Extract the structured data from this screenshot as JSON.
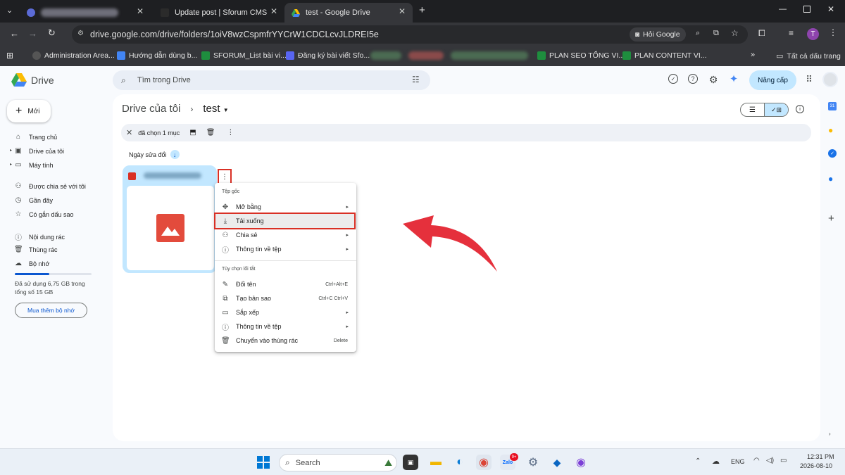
{
  "browser": {
    "tabs": [
      {
        "label": ""
      },
      {
        "label": "Update post | Sforum CMS"
      },
      {
        "label": "test - Google Drive"
      }
    ],
    "url": "drive.google.com/drive/folders/1oiV8wzCspmfrYYCrW1CDCLcvJLDREI5e",
    "ask_google_label": "Hỏi Google",
    "profile_initial": "T",
    "bookmarks": [
      {
        "label": "Administration Area..."
      },
      {
        "label": "Hướng dẫn dùng b..."
      },
      {
        "label": "SFORUM_List bài vi..."
      },
      {
        "label": "Đăng ký bài viết Sfo..."
      },
      {
        "label": "PLAN SEO TỔNG VI..."
      },
      {
        "label": "PLAN CONTENT VI..."
      }
    ],
    "all_bookmarks_label": "Tất cả dấu trang"
  },
  "drive": {
    "logo_label": "Drive",
    "search_placeholder": "Tìm trong Drive",
    "upgrade_label": "Nâng cấp",
    "new_label": "Mới",
    "nav": [
      {
        "label": "Trang chủ",
        "icon": "home-icon"
      },
      {
        "label": "Drive của tôi",
        "icon": "drive-icon"
      },
      {
        "label": "Máy tính",
        "icon": "computer-icon"
      },
      {
        "label": "Được chia sẻ với tôi",
        "icon": "shared-icon"
      },
      {
        "label": "Gần đây",
        "icon": "clock-icon"
      },
      {
        "label": "Có gắn dấu sao",
        "icon": "star-icon"
      },
      {
        "label": "Nội dung rác",
        "icon": "spam-icon"
      },
      {
        "label": "Thùng rác",
        "icon": "trash-icon"
      },
      {
        "label": "Bộ nhớ",
        "icon": "cloud-icon"
      }
    ],
    "storage_text": "Đã sử dụng 6,75 GB trong tổng số 15 GB",
    "storage_used_fraction": 0.45,
    "buy_storage_label": "Mua thêm bộ nhớ",
    "breadcrumb": {
      "root": "Drive của tôi",
      "sep": "›",
      "current": "test"
    },
    "selection": {
      "text": "đã chọn 1 mục"
    },
    "sort_label": "Ngày sửa đổi"
  },
  "menu": {
    "section1_header": "Tệp gốc",
    "section1": [
      {
        "label": "Mở bằng",
        "arrow": "▸",
        "shortcut": ""
      },
      {
        "label": "Tải xuống",
        "arrow": "",
        "shortcut": ""
      },
      {
        "label": "Chia sẻ",
        "arrow": "▸",
        "shortcut": ""
      },
      {
        "label": "Thông tin về tệp",
        "arrow": "▸",
        "shortcut": ""
      }
    ],
    "section2_header": "Tùy chọn lối tắt",
    "section2": [
      {
        "label": "Đổi tên",
        "arrow": "",
        "shortcut": "Ctrl+Alt+E"
      },
      {
        "label": "Tạo bản sao",
        "arrow": "",
        "shortcut": "Ctrl+C Ctrl+V"
      },
      {
        "label": "Sắp xếp",
        "arrow": "▸",
        "shortcut": ""
      },
      {
        "label": "Thông tin về tệp",
        "arrow": "▸",
        "shortcut": ""
      },
      {
        "label": "Chuyển vào thùng rác",
        "arrow": "",
        "shortcut": "Delete"
      }
    ]
  },
  "taskbar": {
    "search_label": "Search",
    "lang": "ENG",
    "time": "12:31 PM",
    "date": "2026-08-10",
    "badge": "9+"
  },
  "colors": {
    "highlight_red": "#d93025",
    "arrow_red": "#e5303c",
    "selected_blue": "#c2e7ff"
  }
}
